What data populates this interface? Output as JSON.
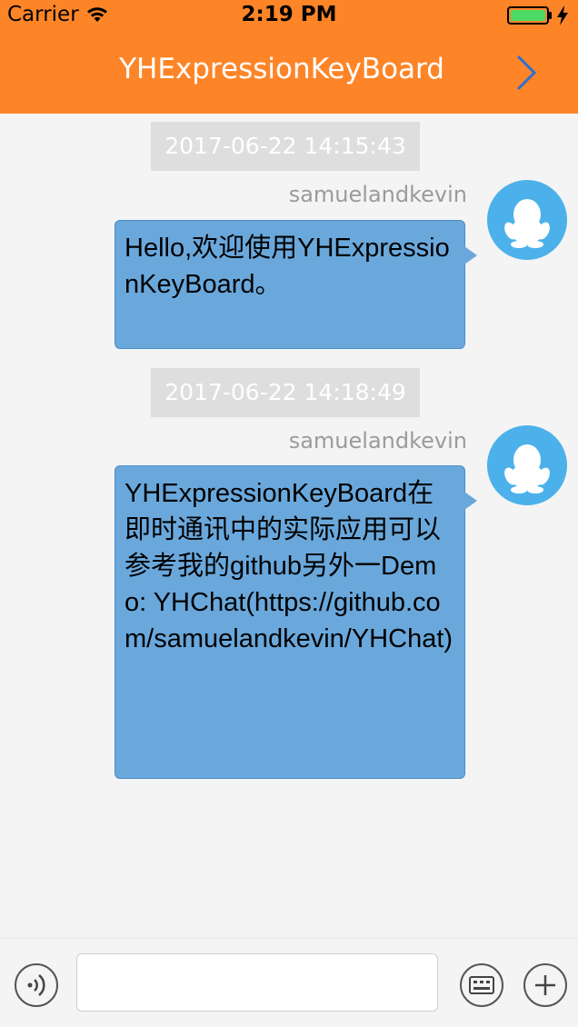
{
  "status_bar": {
    "carrier": "Carrier",
    "time": "2:19 PM",
    "icons": [
      "wifi-icon",
      "battery-icon",
      "charging-icon"
    ]
  },
  "nav": {
    "title": "YHExpressionKeyBoard",
    "right_icon": "chevron-right-icon"
  },
  "messages": [
    {
      "timestamp": "2017-06-22 14:15:43",
      "sender": "samuelandkevin",
      "text": "Hello,欢迎使用YHExpressionKeyBoard。"
    },
    {
      "timestamp": "2017-06-22 14:18:49",
      "sender": "samuelandkevin",
      "text": "YHExpressionKeyBoard在即时通讯中的实际应用可以参考我的github另外一Demo: YHChat(https://github.com/samuelandkevin/YHChat)"
    }
  ],
  "toolbar": {
    "input_value": "",
    "input_placeholder": "",
    "icons": [
      "voice-icon",
      "emoji-keyboard-icon",
      "plus-icon"
    ]
  },
  "colors": {
    "nav_background": "#fd8528",
    "bubble": "#6aa8dc",
    "avatar": "#4cb1ea",
    "chat_background": "#f4f4f4"
  }
}
